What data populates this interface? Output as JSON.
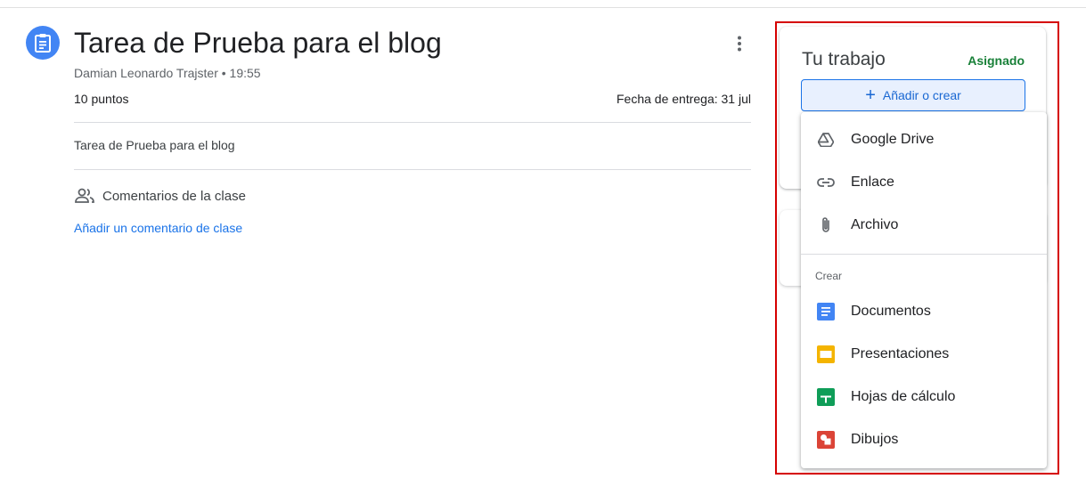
{
  "assignment": {
    "title": "Tarea de Prueba para el blog",
    "meta": "Damian Leonardo Trajster • 19:55",
    "points": "10 puntos",
    "due": "Fecha de entrega: 31 jul",
    "description": "Tarea de Prueba para el blog"
  },
  "comments": {
    "label": "Comentarios de la clase",
    "add_link": "Añadir un comentario de clase"
  },
  "work": {
    "title": "Tu trabajo",
    "status": "Asignado",
    "add_button": "Añadir o crear"
  },
  "menu": {
    "attach_items": [
      {
        "label": "Google Drive",
        "icon": "google-drive-icon"
      },
      {
        "label": "Enlace",
        "icon": "link-icon"
      },
      {
        "label": "Archivo",
        "icon": "paperclip-icon"
      }
    ],
    "create_section": "Crear",
    "create_items": [
      {
        "label": "Documentos",
        "icon": "docs-icon",
        "color": "#4285f4"
      },
      {
        "label": "Presentaciones",
        "icon": "slides-icon",
        "color": "#f4b400"
      },
      {
        "label": "Hojas de cálculo",
        "icon": "sheets-icon",
        "color": "#0f9d58"
      },
      {
        "label": "Dibujos",
        "icon": "drawings-icon",
        "color": "#db4437"
      }
    ]
  },
  "colors": {
    "accent": "#1a73e8",
    "status_green": "#188038",
    "highlight_border": "#d50000"
  }
}
